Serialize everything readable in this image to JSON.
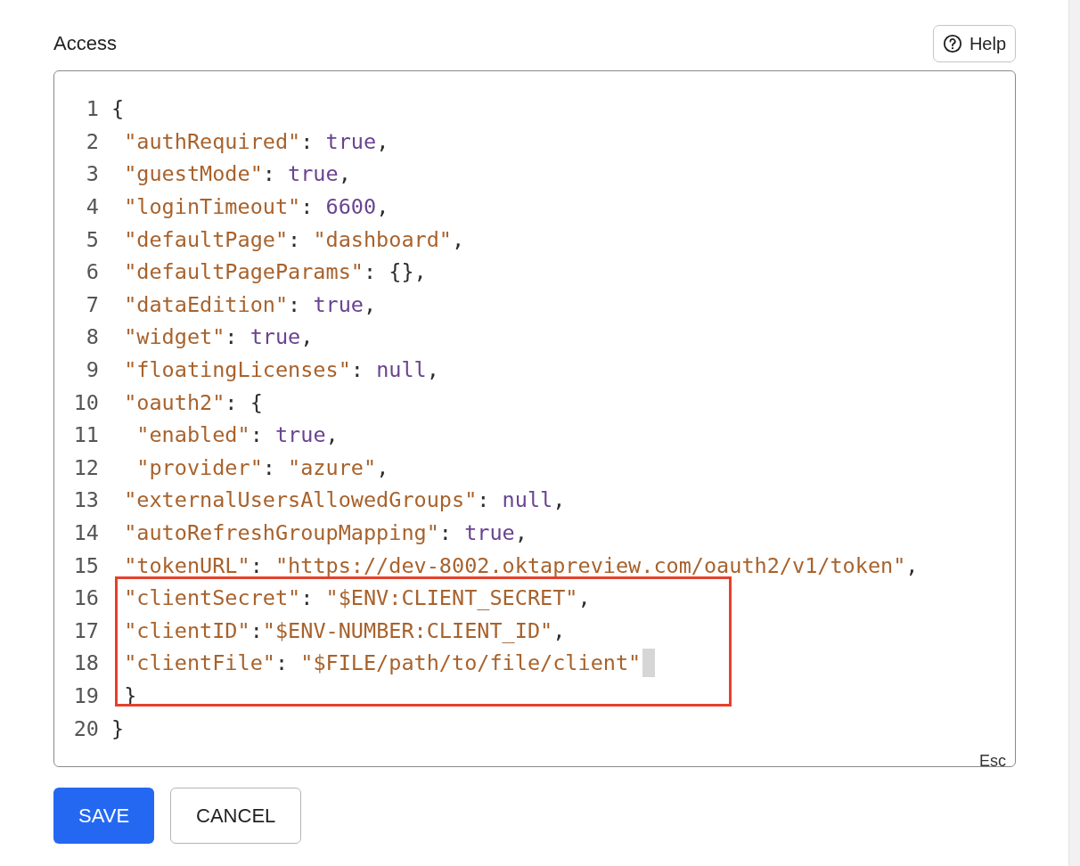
{
  "section": {
    "title": "Access",
    "help_button": {
      "label": "Help"
    }
  },
  "editor": {
    "lines": [
      {
        "number": "1",
        "tokens": [
          {
            "kind": "punct",
            "text": "{"
          }
        ]
      },
      {
        "number": "2",
        "tokens": [
          {
            "kind": "key",
            "text": " \"authRequired\""
          },
          {
            "kind": "punct",
            "text": ": "
          },
          {
            "kind": "literal",
            "text": "true"
          },
          {
            "kind": "punct",
            "text": ","
          }
        ]
      },
      {
        "number": "3",
        "tokens": [
          {
            "kind": "key",
            "text": " \"guestMode\""
          },
          {
            "kind": "punct",
            "text": ": "
          },
          {
            "kind": "literal",
            "text": "true"
          },
          {
            "kind": "punct",
            "text": ","
          }
        ]
      },
      {
        "number": "4",
        "tokens": [
          {
            "kind": "key",
            "text": " \"loginTimeout\""
          },
          {
            "kind": "punct",
            "text": ": "
          },
          {
            "kind": "literal",
            "text": "6600"
          },
          {
            "kind": "punct",
            "text": ","
          }
        ]
      },
      {
        "number": "5",
        "tokens": [
          {
            "kind": "key",
            "text": " \"defaultPage\""
          },
          {
            "kind": "punct",
            "text": ": "
          },
          {
            "kind": "string",
            "text": "\"dashboard\""
          },
          {
            "kind": "punct",
            "text": ","
          }
        ]
      },
      {
        "number": "6",
        "tokens": [
          {
            "kind": "key",
            "text": " \"defaultPageParams\""
          },
          {
            "kind": "punct",
            "text": ": {},"
          }
        ]
      },
      {
        "number": "7",
        "tokens": [
          {
            "kind": "key",
            "text": " \"dataEdition\""
          },
          {
            "kind": "punct",
            "text": ": "
          },
          {
            "kind": "literal",
            "text": "true"
          },
          {
            "kind": "punct",
            "text": ","
          }
        ]
      },
      {
        "number": "8",
        "tokens": [
          {
            "kind": "key",
            "text": " \"widget\""
          },
          {
            "kind": "punct",
            "text": ": "
          },
          {
            "kind": "literal",
            "text": "true"
          },
          {
            "kind": "punct",
            "text": ","
          }
        ]
      },
      {
        "number": "9",
        "tokens": [
          {
            "kind": "key",
            "text": " \"floatingLicenses\""
          },
          {
            "kind": "punct",
            "text": ": "
          },
          {
            "kind": "literal",
            "text": "null"
          },
          {
            "kind": "punct",
            "text": ","
          }
        ]
      },
      {
        "number": "10",
        "tokens": [
          {
            "kind": "key",
            "text": " \"oauth2\""
          },
          {
            "kind": "punct",
            "text": ": {"
          }
        ]
      },
      {
        "number": "11",
        "tokens": [
          {
            "kind": "key",
            "text": "  \"enabled\""
          },
          {
            "kind": "punct",
            "text": ": "
          },
          {
            "kind": "literal",
            "text": "true"
          },
          {
            "kind": "punct",
            "text": ","
          }
        ]
      },
      {
        "number": "12",
        "tokens": [
          {
            "kind": "key",
            "text": "  \"provider\""
          },
          {
            "kind": "punct",
            "text": ": "
          },
          {
            "kind": "string",
            "text": "\"azure\""
          },
          {
            "kind": "punct",
            "text": ","
          }
        ]
      },
      {
        "number": "13",
        "tokens": [
          {
            "kind": "key",
            "text": " \"externalUsersAllowedGroups\""
          },
          {
            "kind": "punct",
            "text": ": "
          },
          {
            "kind": "literal",
            "text": "null"
          },
          {
            "kind": "punct",
            "text": ","
          }
        ]
      },
      {
        "number": "14",
        "tokens": [
          {
            "kind": "key",
            "text": " \"autoRefreshGroupMapping\""
          },
          {
            "kind": "punct",
            "text": ": "
          },
          {
            "kind": "literal",
            "text": "true"
          },
          {
            "kind": "punct",
            "text": ","
          }
        ]
      },
      {
        "number": "15",
        "tokens": [
          {
            "kind": "key",
            "text": " \"tokenURL\""
          },
          {
            "kind": "punct",
            "text": ": "
          },
          {
            "kind": "string",
            "text": "\"https://dev-8002.oktapreview.com/oauth2/v1/token\""
          },
          {
            "kind": "punct",
            "text": ","
          }
        ]
      },
      {
        "number": "16",
        "highlighted": true,
        "tokens": [
          {
            "kind": "key",
            "text": " \"clientSecret\""
          },
          {
            "kind": "punct",
            "text": ": "
          },
          {
            "kind": "string",
            "text": "\"$ENV:CLIENT_SECRET\""
          },
          {
            "kind": "punct",
            "text": ","
          }
        ]
      },
      {
        "number": "17",
        "highlighted": true,
        "tokens": [
          {
            "kind": "key",
            "text": " \"clientID\""
          },
          {
            "kind": "punct",
            "text": ":"
          },
          {
            "kind": "string",
            "text": "\"$ENV-NUMBER:CLIENT_ID\""
          },
          {
            "kind": "punct",
            "text": ","
          }
        ]
      },
      {
        "number": "18",
        "highlighted": true,
        "cursor": true,
        "tokens": [
          {
            "kind": "key",
            "text": " \"clientFile\""
          },
          {
            "kind": "punct",
            "text": ": "
          },
          {
            "kind": "string",
            "text": "\"$FILE/path/to/file/client\""
          }
        ]
      },
      {
        "number": "19",
        "highlighted": true,
        "tokens": [
          {
            "kind": "punct",
            "text": " }"
          }
        ]
      },
      {
        "number": "20",
        "tokens": [
          {
            "kind": "punct",
            "text": "}"
          }
        ]
      }
    ],
    "esc_hint": "Esc"
  },
  "buttons": [
    {
      "label": "SAVE",
      "kind": "primary"
    },
    {
      "label": "CANCEL",
      "kind": "secondary"
    }
  ]
}
